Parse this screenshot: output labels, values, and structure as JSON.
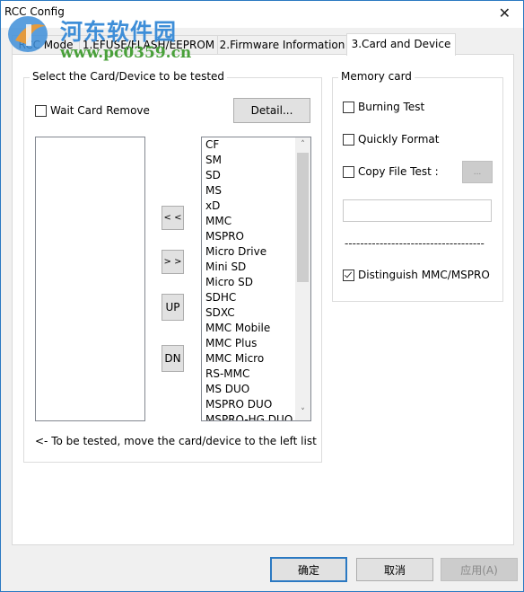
{
  "window": {
    "title": "RCC Config",
    "close_glyph": "✕"
  },
  "watermark": {
    "site_name": "河东软件园",
    "url": "www.pc0359.cn"
  },
  "tabs": [
    {
      "label": "RCC Mode",
      "active": false
    },
    {
      "label": "1.EFUSE/FLASH/EEPROM",
      "active": false
    },
    {
      "label": "2.Firmware Information",
      "active": false
    },
    {
      "label": "3.Card and Device",
      "active": true
    }
  ],
  "select_group": {
    "label": "Select the Card/Device to be tested",
    "wait_card_remove": {
      "label": "Wait Card Remove",
      "checked": false
    },
    "detail_button": "Detail...",
    "left_list": [],
    "move_left_button": "< <",
    "move_right_button": "> >",
    "up_button": "UP",
    "down_button": "DN",
    "right_list": [
      "CF",
      "SM",
      "SD",
      "MS",
      "xD",
      "MMC",
      "MSPRO",
      "Micro Drive",
      "Mini SD",
      "Micro SD",
      "SDHC",
      "SDXC",
      "MMC Mobile",
      "MMC Plus",
      "MMC Micro",
      "RS-MMC",
      "MS DUO",
      "MSPRO DUO",
      "MSPRO-HG DUO"
    ],
    "right_list_scroll": {
      "up_arrow": "˄",
      "down_arrow": "˅"
    },
    "hint": "<- To be tested, move the card/device to the left list"
  },
  "memory_group": {
    "label": "Memory card",
    "burning_test": {
      "label": "Burning Test",
      "checked": false
    },
    "quickly_format": {
      "label": "Quickly Format",
      "checked": false
    },
    "copy_file_test": {
      "label": "Copy File Test :",
      "checked": false
    },
    "browse_button": "...",
    "path_value": "",
    "separator": "------------------------------------",
    "distinguish": {
      "label": "Distinguish MMC/MSPRO",
      "checked": true
    }
  },
  "footer": {
    "ok_button": "确定",
    "cancel_button": "取消",
    "apply_button": "应用(A)"
  },
  "colors": {
    "accent": "#2b79c2",
    "panel_bg": "#f0f0f0",
    "button_bg": "#e1e1e1",
    "disabled_bg": "#cccccc"
  }
}
